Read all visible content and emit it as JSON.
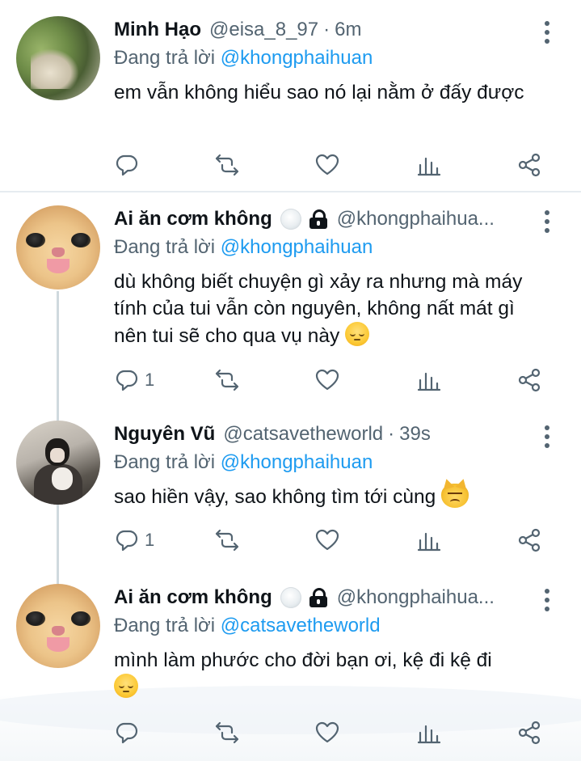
{
  "tweets": [
    {
      "name": "Minh Hạo",
      "handle": "@eisa_8_97",
      "time": "6m",
      "reply_prefix": "Đang trả lời",
      "reply_to": "@khongphaihuan",
      "body": "em vẫn không hiểu sao nó lại nằm ở đấy được",
      "avatar": "plant-photo",
      "reply_count": "",
      "verified_badge": false,
      "locked": false
    },
    {
      "name": "Ai ăn cơm không",
      "handle": "@khongphaihua...",
      "time": "",
      "reply_prefix": "Đang trả lời",
      "reply_to": "@khongphaihuan",
      "body": "dù không biết chuyện gì xảy ra nhưng mà máy tính của tui vẫn còn nguyên, không nất mát gì nên tui sẽ cho qua vụ này",
      "body_emoji": "pensive-face",
      "avatar": "cat-photo",
      "reply_count": "1",
      "verified_badge": true,
      "locked": true
    },
    {
      "name": "Nguyên Vũ",
      "handle": "@catsavetheworld",
      "time": "39s",
      "reply_prefix": "Đang trả lời",
      "reply_to": "@khongphaihuan",
      "body": "sao hiền vậy, sao không tìm tới cùng",
      "body_emoji": "pouting-cat",
      "avatar": "person-photo",
      "reply_count": "1",
      "verified_badge": false,
      "locked": false
    },
    {
      "name": "Ai ăn cơm không",
      "handle": "@khongphaihua...",
      "time": "",
      "reply_prefix": "Đang trả lời",
      "reply_to": "@catsavetheworld",
      "body": "mình làm phước cho đời bạn ơi, kệ đi kệ đi",
      "body_emoji": "pensive-face",
      "avatar": "cat-photo",
      "reply_count": "",
      "verified_badge": true,
      "locked": true
    }
  ],
  "icons": {
    "reply": "reply-icon",
    "retweet": "retweet-icon",
    "like": "heart-icon",
    "analytics": "analytics-icon",
    "share": "share-icon",
    "more": "more-vertical-icon"
  },
  "colors": {
    "mention": "#1d9bf0",
    "secondary_text": "#536471",
    "thread_line": "#cfd9de"
  }
}
